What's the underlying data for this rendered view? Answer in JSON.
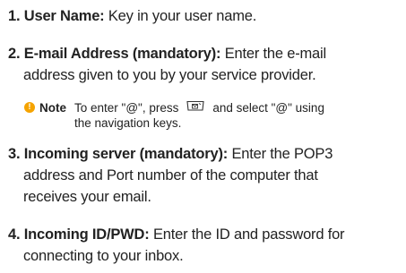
{
  "items": [
    {
      "num": "1.",
      "term": "User Name:",
      "desc": "Key in your user name."
    },
    {
      "num": "2.",
      "term": "E-mail Address (mandatory):",
      "desc": "Enter the e-mail",
      "cont": "address given to you by your service provider."
    },
    {
      "num": "3.",
      "term": "Incoming server (mandatory):",
      "desc": "Enter the POP3",
      "cont1": "address and Port number of the computer that",
      "cont2": "receives your email."
    },
    {
      "num": "4.",
      "term": "Incoming ID/PWD:",
      "desc": "Enter the ID and password for",
      "cont": "connecting to your inbox."
    }
  ],
  "note": {
    "icon": "info-icon",
    "icon_glyph": "!",
    "label": "Note",
    "text_before": "To enter \"@\", press",
    "text_after": "and select  \"@\" using",
    "text_line2": "the navigation keys.",
    "key_icon": "message-key-icon"
  }
}
